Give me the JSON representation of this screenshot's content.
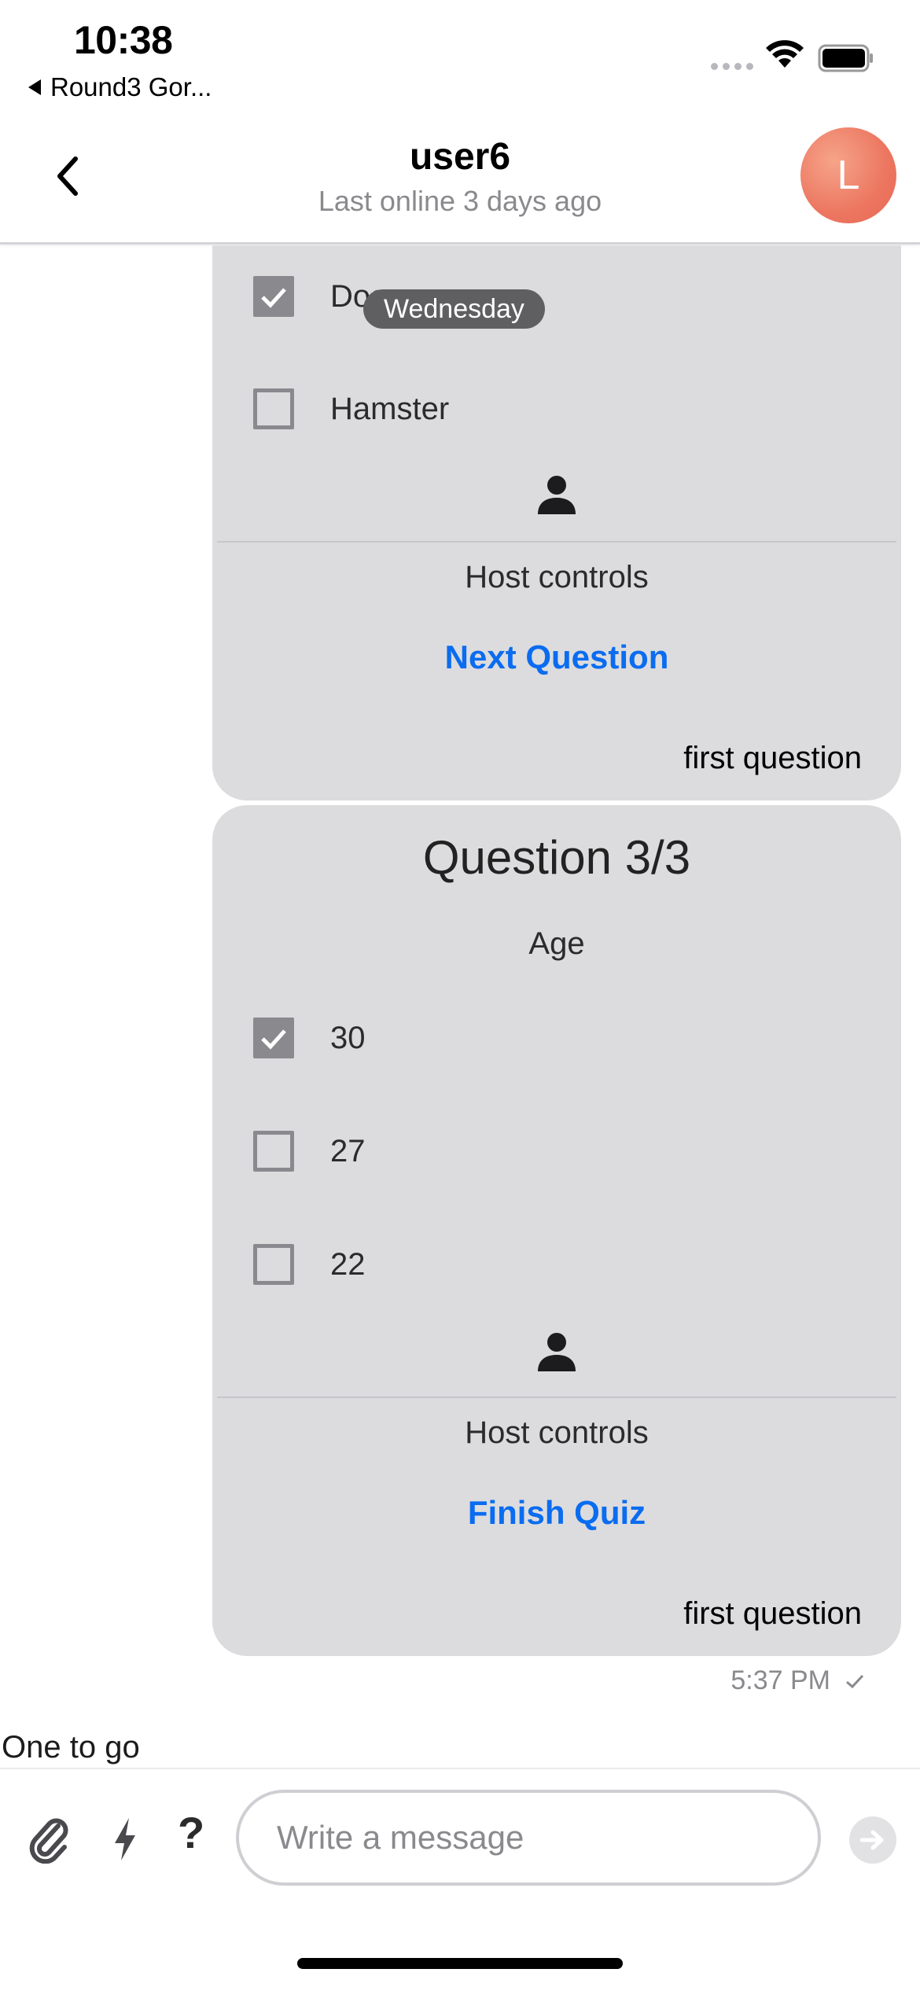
{
  "status_bar": {
    "time": "10:38",
    "back_app": "Round3 Gor..."
  },
  "header": {
    "title": "user6",
    "subtitle": "Last online 3 days ago",
    "avatar_initial": "L",
    "avatar_color": "#ec7660"
  },
  "date_separator": "Wednesday",
  "quiz_card_1": {
    "options": [
      {
        "label": "Dog",
        "checked": true
      },
      {
        "label": "Hamster",
        "checked": false
      }
    ],
    "host_controls_label": "Host controls",
    "action_label": "Next Question",
    "caption": "first question"
  },
  "quiz_card_2": {
    "title": "Question 3/3",
    "question": "Age",
    "options": [
      {
        "label": "30",
        "checked": true
      },
      {
        "label": "27",
        "checked": false
      },
      {
        "label": "22",
        "checked": false
      }
    ],
    "host_controls_label": "Host controls",
    "action_label": "Finish Quiz",
    "caption": "first question"
  },
  "message_meta": {
    "time": "5:37 PM"
  },
  "conversation_preview": "One to go",
  "composer": {
    "placeholder": "Write a message",
    "value": ""
  },
  "colors": {
    "accent": "#0a6cf0",
    "bubble": "#dcdcde"
  }
}
